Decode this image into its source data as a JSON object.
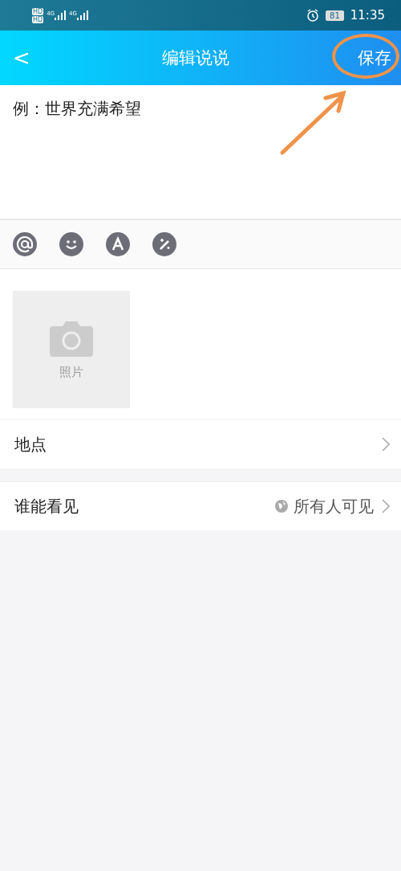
{
  "status_bar": {
    "network": [
      "HD",
      "HD"
    ],
    "signal": [
      "4G",
      "4G"
    ],
    "battery": "81",
    "time": "11:35"
  },
  "header": {
    "back": "<",
    "title": "编辑说说",
    "action": "保存"
  },
  "editor": {
    "placeholder": "例：世界充满希望"
  },
  "toolbar": [
    {
      "kind": "mention"
    },
    {
      "kind": "emoji"
    },
    {
      "kind": "font"
    },
    {
      "kind": "magic"
    }
  ],
  "photo": {
    "label": "照片"
  },
  "rows": [
    {
      "label": "地点"
    },
    {
      "label": "谁能看见",
      "value": "所有人可见"
    }
  ]
}
